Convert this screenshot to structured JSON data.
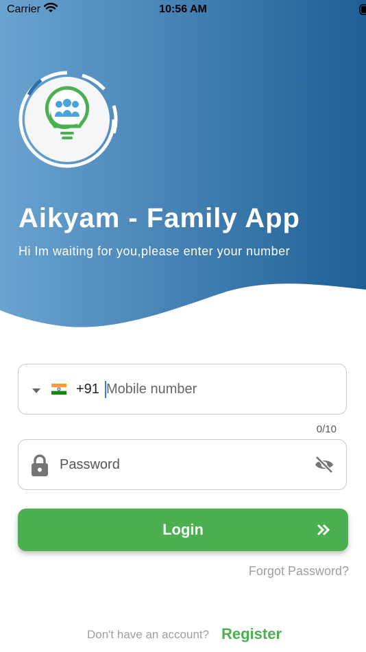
{
  "status_bar": {
    "carrier": "Carrier",
    "time": "10:56 AM"
  },
  "hero": {
    "title": "Aikyam - Family App",
    "subtitle": "Hi Im waiting for you,please enter your number",
    "gradient_start": "#6aa3d0",
    "gradient_end": "#1f5f96"
  },
  "form": {
    "phone": {
      "country_code": "+91",
      "placeholder": "Mobile number",
      "value": "",
      "counter": "0/10"
    },
    "password": {
      "placeholder": "Password",
      "value": ""
    },
    "login_label": "Login",
    "forgot_label": "Forgot Password?",
    "no_account_text": "Don't have an account?",
    "register_label": "Register"
  },
  "colors": {
    "accent": "#4caf50",
    "muted_text": "#9e9e9e",
    "field_border": "#c8c8c8"
  },
  "icons": [
    "wifi-icon",
    "battery-icon",
    "app-logo-icon",
    "india-flag-icon",
    "dropdown-arrow-icon",
    "lock-icon",
    "eye-off-icon",
    "double-chevron-right-icon"
  ]
}
